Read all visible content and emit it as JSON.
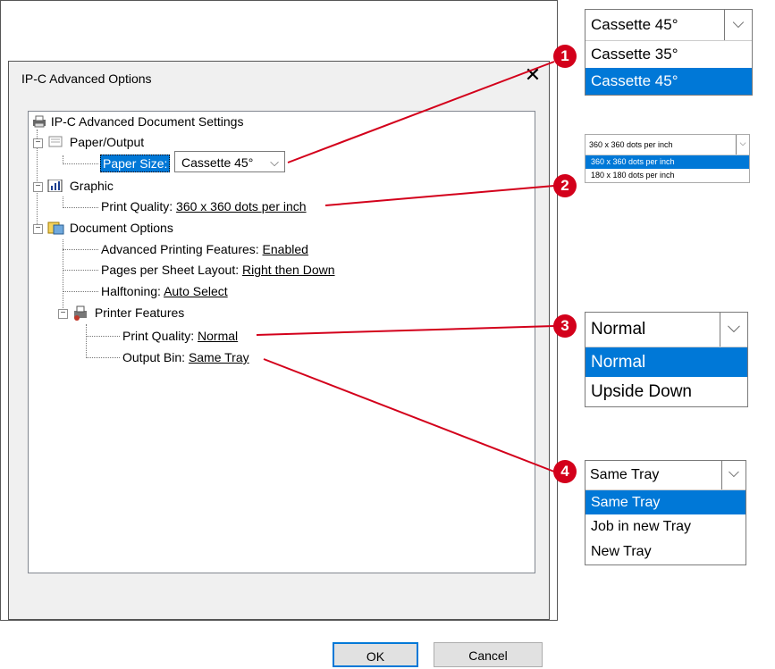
{
  "dialog": {
    "title": "IP-C Advanced Options",
    "close_glyph": "✕"
  },
  "tree": {
    "root": "IP-C Advanced Document Settings",
    "paper_output": "Paper/Output",
    "paper_size_label": "Paper Size:",
    "paper_size_value": "Cassette 45°",
    "graphic": "Graphic",
    "print_quality_label": "Print Quality:",
    "print_quality_value": "360 x 360 dots per inch",
    "document_options": "Document Options",
    "advanced_printing_label": "Advanced Printing Features:",
    "advanced_printing_value": "Enabled",
    "pages_per_sheet_label": "Pages per Sheet Layout:",
    "pages_per_sheet_value": "Right then Down",
    "halftoning_label": "Halftoning:",
    "halftoning_value": "Auto Select",
    "printer_features": "Printer Features",
    "pf_print_quality_label": "Print Quality:",
    "pf_print_quality_value": "Normal",
    "output_bin_label": "Output Bin:",
    "output_bin_value": "Same Tray",
    "expander_glyph": "−"
  },
  "buttons": {
    "ok": "OK",
    "cancel": "Cancel"
  },
  "callouts": {
    "c1": {
      "badge": "1",
      "selected": "Cassette 45°",
      "options": [
        "Cassette 35°",
        "Cassette 45°"
      ],
      "highlight_index": 1
    },
    "c2": {
      "badge": "2",
      "selected": "360 x 360 dots per inch",
      "options": [
        "360 x 360 dots per inch",
        "180 x 180 dots per inch"
      ],
      "highlight_index": 0
    },
    "c3": {
      "badge": "3",
      "selected": "Normal",
      "options": [
        "Normal",
        "Upside Down"
      ],
      "highlight_index": 0
    },
    "c4": {
      "badge": "4",
      "selected": "Same Tray",
      "options": [
        "Same Tray",
        "Job in new Tray",
        "New Tray"
      ],
      "highlight_index": 0
    }
  },
  "icons": {
    "dropdown_arrow": "⌵",
    "combo_chevron": "⌵"
  },
  "colors": {
    "callout_red": "#d3001b",
    "selection_blue": "#0078d7"
  }
}
